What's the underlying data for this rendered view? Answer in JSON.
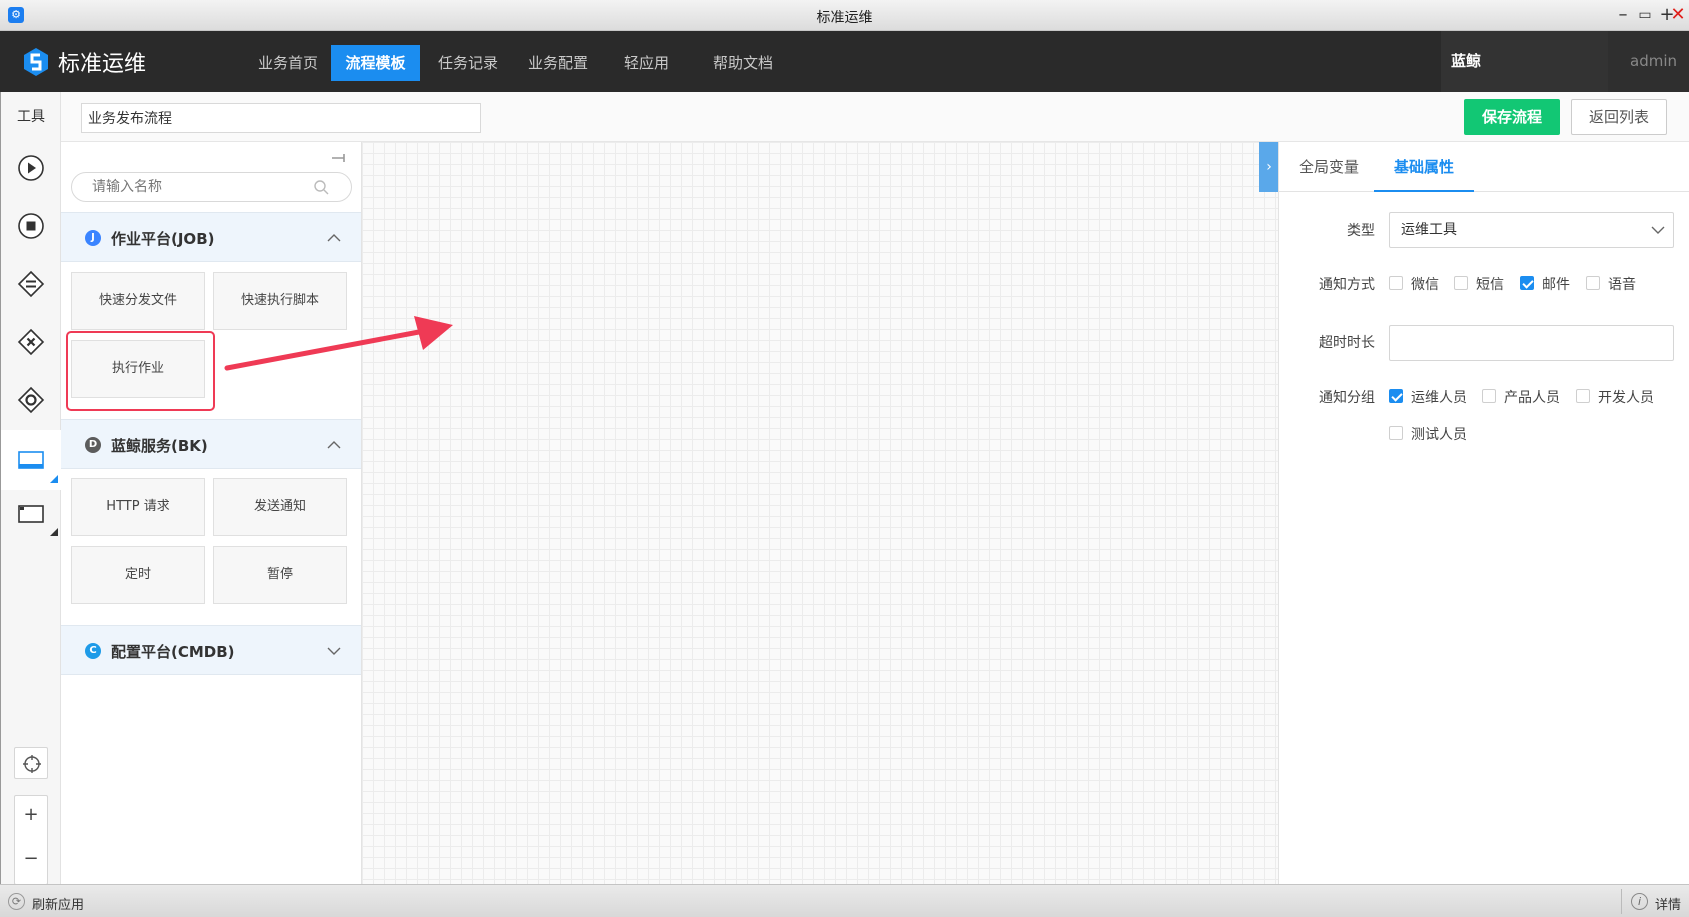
{
  "window": {
    "title": "标准运维"
  },
  "nav": {
    "brand": "标准运维",
    "items": [
      {
        "label": "业务首页",
        "active": false
      },
      {
        "label": "流程模板",
        "active": true
      },
      {
        "label": "任务记录",
        "active": false
      },
      {
        "label": "业务配置",
        "active": false
      },
      {
        "label": "轻应用",
        "active": false
      },
      {
        "label": "帮助文档",
        "active": false
      }
    ],
    "business": "蓝鲸",
    "user": "admin"
  },
  "tools": {
    "label": "工具",
    "icons": [
      "start-node-icon",
      "end-node-icon",
      "parallel-gateway-icon",
      "branch-gateway-icon",
      "converge-gateway-icon",
      "task-node-icon",
      "subprocess-icon"
    ],
    "zoom_in": "+",
    "zoom_out": "−"
  },
  "toolbar": {
    "flow_name": "业务发布流程",
    "save_label": "保存流程",
    "back_label": "返回列表"
  },
  "palette": {
    "search_placeholder": "请输入名称",
    "groups": [
      {
        "badge": "J",
        "title": "作业平台(JOB)",
        "color": "#3a84ff",
        "expanded": true,
        "items": [
          "快速分发文件",
          "快速执行脚本",
          "执行作业"
        ]
      },
      {
        "badge": "D",
        "title": "蓝鲸服务(BK)",
        "color": "#5c5c5c",
        "expanded": true,
        "items": [
          "HTTP 请求",
          "发送通知",
          "定时",
          "暂停"
        ]
      },
      {
        "badge": "C",
        "title": "配置平台(CMDB)",
        "color": "#1e9be8",
        "expanded": false,
        "items": []
      }
    ]
  },
  "rightpanel": {
    "tabs": [
      {
        "label": "全局变量",
        "active": false
      },
      {
        "label": "基础属性",
        "active": true
      }
    ],
    "type_label": "类型",
    "type_value": "运维工具",
    "notify_label": "通知方式",
    "notify_options": [
      {
        "label": "微信",
        "checked": false
      },
      {
        "label": "短信",
        "checked": false
      },
      {
        "label": "邮件",
        "checked": true
      },
      {
        "label": "语音",
        "checked": false
      }
    ],
    "timeout_label": "超时时长",
    "timeout_value": "",
    "group_label": "通知分组",
    "group_options": [
      {
        "label": "运维人员",
        "checked": true
      },
      {
        "label": "产品人员",
        "checked": false
      },
      {
        "label": "开发人员",
        "checked": false
      },
      {
        "label": "测试人员",
        "checked": false
      }
    ]
  },
  "statusbar": {
    "refresh": "刷新应用",
    "detail": "详情"
  },
  "colors": {
    "accent": "#1b8df0",
    "save": "#12c774",
    "highlight": "#ef3a55"
  }
}
